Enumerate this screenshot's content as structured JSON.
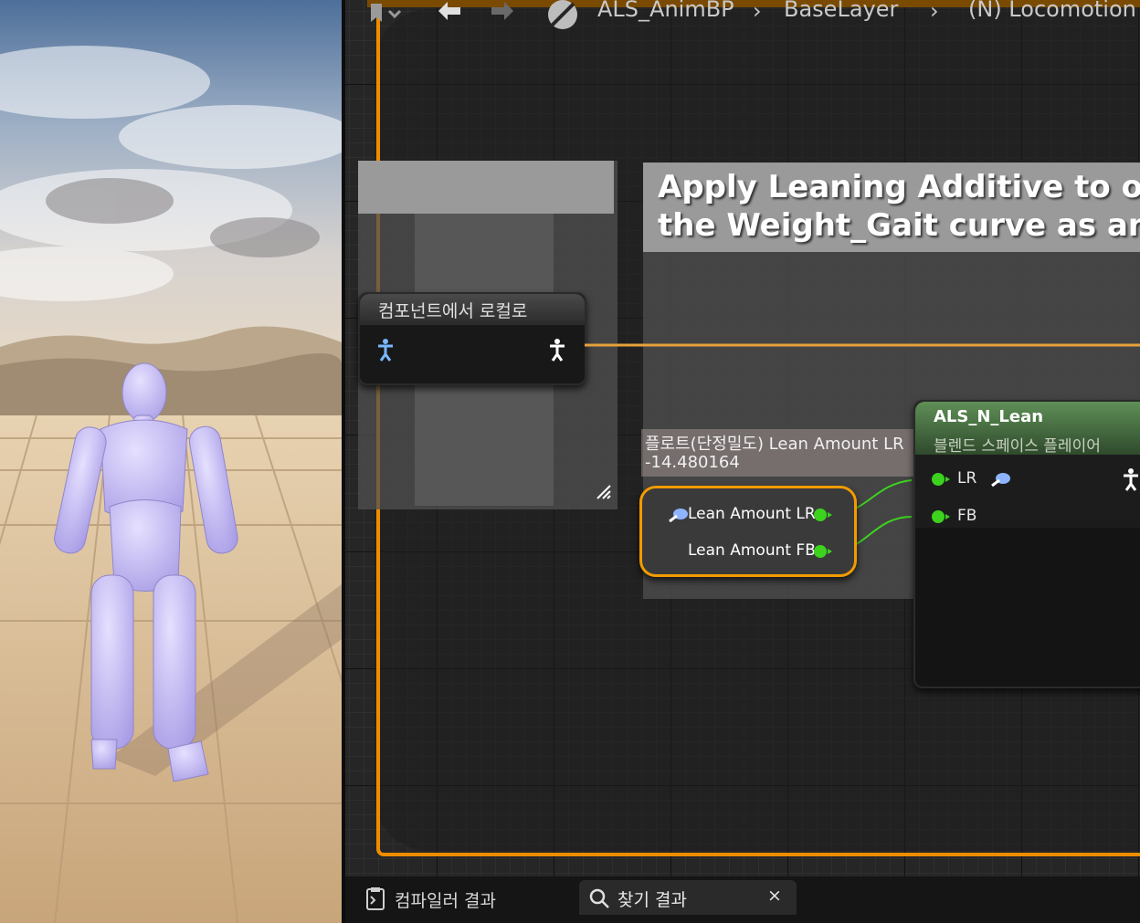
{
  "breadcrumb": {
    "items": [
      "ALS_AnimBP",
      "BaseLayer",
      "(N) Locomotion"
    ]
  },
  "comments": {
    "apply_leaning": "Apply Leaning Additive to only th\nthe Weight_Gait curve as an alph"
  },
  "nodes": {
    "component_to_local": {
      "title": "컴포넌트에서 로컬로"
    },
    "lean_amount": {
      "pin_lr_label": "Lean Amount LR",
      "pin_fb_label": "Lean Amount FB"
    },
    "als_n_lean": {
      "title": "ALS_N_Lean",
      "subtitle": "블렌드 스페이스 플레이어",
      "pin_lr": "LR",
      "pin_fb": "FB"
    }
  },
  "tooltip": {
    "line1": "플로트(단정밀도) Lean Amount LR",
    "line2": "-14.480164"
  },
  "tabs": [
    {
      "label": "컴파일러 결과",
      "icon": "compiler-results-icon"
    },
    {
      "label": "찾기 결과",
      "icon": "search-icon",
      "close": "×"
    }
  ],
  "colors": {
    "state_border": "#f08c00",
    "exec_pin": "#3cd21e",
    "node_selected": "#f29b00",
    "blendspace_header": "#4f7a48"
  }
}
